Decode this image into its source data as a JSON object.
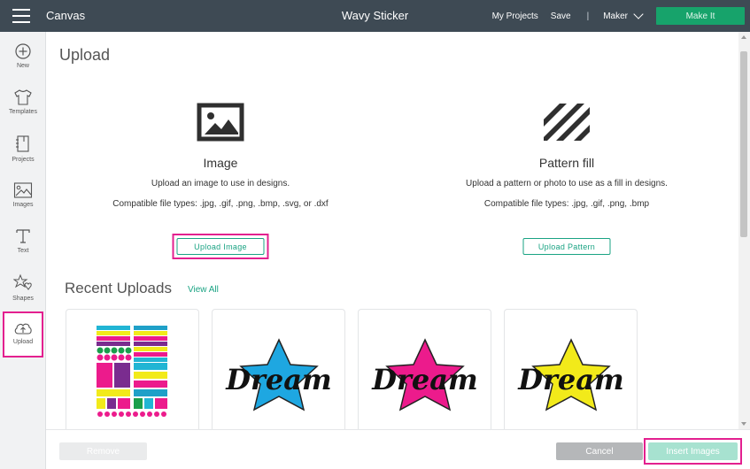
{
  "header": {
    "app_name": "Canvas",
    "project_title": "Wavy Sticker",
    "my_projects": "My Projects",
    "save": "Save",
    "separator": "|",
    "machine": "Maker",
    "make_it": "Make It"
  },
  "sidebar": {
    "items": [
      {
        "label": "New",
        "icon": "plus-circle-icon"
      },
      {
        "label": "Templates",
        "icon": "shirt-icon"
      },
      {
        "label": "Projects",
        "icon": "notebook-icon"
      },
      {
        "label": "Images",
        "icon": "image-icon"
      },
      {
        "label": "Text",
        "icon": "text-icon"
      },
      {
        "label": "Shapes",
        "icon": "shapes-icon"
      },
      {
        "label": "Upload",
        "icon": "cloud-upload-icon",
        "active": true
      }
    ]
  },
  "main": {
    "title": "Upload",
    "image_card": {
      "title": "Image",
      "description": "Upload an image to use in designs.",
      "file_types": "Compatible file types: .jpg, .gif, .png, .bmp, .svg, or .dxf",
      "button": "Upload Image"
    },
    "pattern_card": {
      "title": "Pattern fill",
      "description": "Upload a pattern or photo to use as a fill in designs.",
      "file_types": "Compatible file types: .jpg, .gif, .png, .bmp",
      "button": "Upload Pattern"
    },
    "recent": {
      "title": "Recent Uploads",
      "view_all": "View All",
      "thumbnails": [
        {
          "kind": "sticker-sheet"
        },
        {
          "kind": "dream-star",
          "star_color": "#1ea7e1",
          "word": "Dream"
        },
        {
          "kind": "dream-star",
          "star_color": "#ec1b8c",
          "word": "Dream"
        },
        {
          "kind": "dream-star",
          "star_color": "#f2ea1a",
          "word": "Dream"
        }
      ]
    }
  },
  "footer": {
    "remove": "Remove",
    "cancel": "Cancel",
    "insert": "Insert Images"
  },
  "colors": {
    "topbar": "#3e4a54",
    "accent_green": "#1aa383",
    "make_it": "#17a36b",
    "highlight": "#e3208f"
  }
}
